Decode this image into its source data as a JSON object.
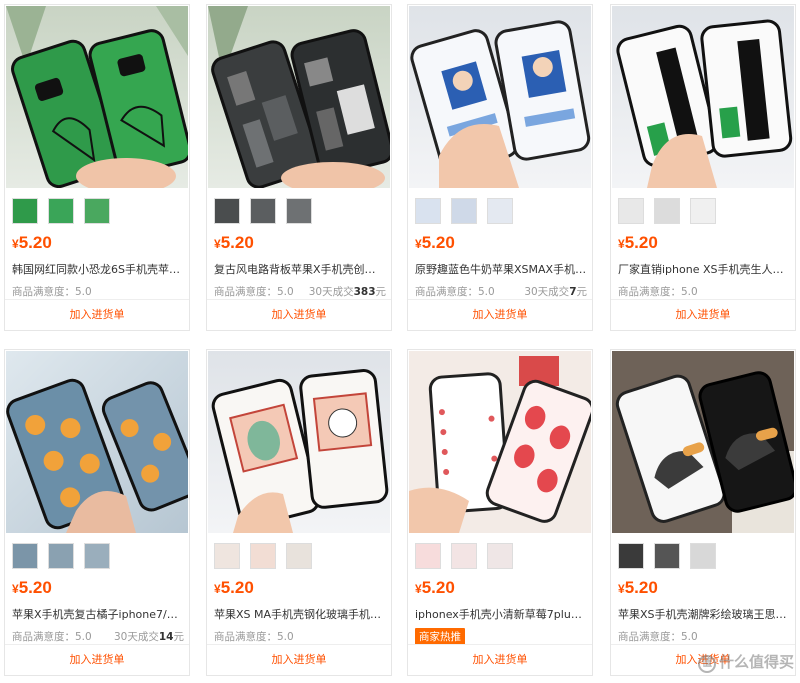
{
  "colors": {
    "price": "#ff5000",
    "badge": "#ff6a00"
  },
  "labels": {
    "add_to_cart": "加入进货单",
    "satisfaction_prefix": "商品满意度：",
    "sales_prefix": "30天成交",
    "sales_suffix": "元",
    "currency": "¥"
  },
  "products": [
    {
      "price": "5.20",
      "title": "韩国网红同款小恐龙6S手机壳苹果X/7...",
      "satisfaction": "5.0",
      "sales": "",
      "badge": "",
      "image": "green-dinosaur-phone-case"
    },
    {
      "price": "5.20",
      "title": "复古风电路背板苹果X手机壳创意防摔...",
      "satisfaction": "5.0",
      "sales": "383",
      "badge": "",
      "image": "circuit-board-phone-case"
    },
    {
      "price": "5.20",
      "title": "原野趣蓝色牛奶苹果XSMAX手机壳iph...",
      "satisfaction": "5.0",
      "sales": "7",
      "badge": "",
      "image": "milk-girl-phone-case"
    },
    {
      "price": "5.20",
      "title": "厂家直销iphone XS手机壳生人勿近创...",
      "satisfaction": "5.0",
      "sales": "",
      "badge": "",
      "image": "strangers-keep-away-phone-case"
    },
    {
      "price": "5.20",
      "title": "苹果X手机壳复古橘子iphone7/8plu彩...",
      "satisfaction": "5.0",
      "sales": "14",
      "badge": "",
      "image": "orange-pattern-phone-case"
    },
    {
      "price": "5.20",
      "title": "苹果XS MA手机壳钢化玻璃手机壳ipho...",
      "satisfaction": "5.0",
      "sales": "",
      "badge": "",
      "image": "cartoon-dino-cat-phone-case"
    },
    {
      "price": "5.20",
      "title": "iphonex手机壳小清新草莓7plus镭射...",
      "satisfaction": "",
      "sales": "",
      "badge": "商家热推",
      "image": "strawberry-phone-case"
    },
    {
      "price": "5.20",
      "title": "苹果XS手机壳潮牌彩绘玻璃王思聪热...",
      "satisfaction": "5.0",
      "sales": "",
      "badge": "",
      "image": "cartoon-character-phone-case"
    }
  ],
  "watermark": "值 什么值得买"
}
